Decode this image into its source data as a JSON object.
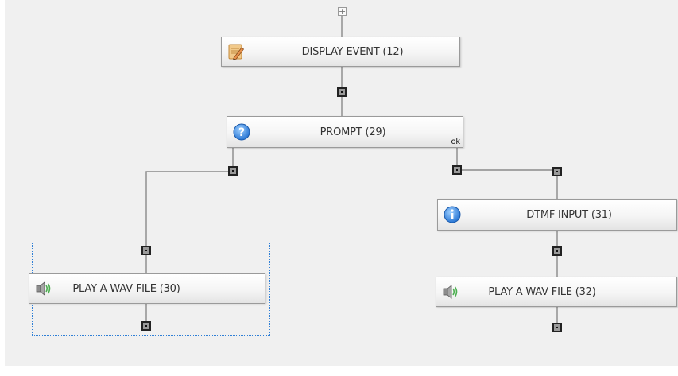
{
  "canvas": {
    "expand_glyph": "+",
    "nodes": {
      "display_event": {
        "label": "DISPLAY EVENT (12)",
        "icon": "notepad-pencil-icon"
      },
      "prompt": {
        "label": "PROMPT (29)",
        "icon": "question-icon",
        "ok_label": "ok"
      },
      "dtmf_input": {
        "label": "DTMF INPUT (31)",
        "icon": "info-icon"
      },
      "play_wav_30": {
        "label": "PLAY A WAV FILE (30)",
        "icon": "speaker-icon"
      },
      "play_wav_32": {
        "label": "PLAY A WAV FILE (32)",
        "icon": "speaker-icon"
      }
    },
    "selected_node": "PLAY A WAV FILE (30)",
    "colors": {
      "background": "#f0f0f0",
      "node_border": "#9a9a9a",
      "port_fill": "#9a9a9a",
      "wire": "#8a8a8a",
      "selection": "#2f7fd6"
    }
  }
}
